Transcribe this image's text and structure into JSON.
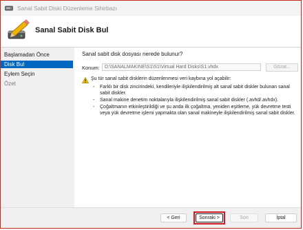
{
  "window": {
    "title": "Sanal Sabit Diski Düzenleme Sihirbazı"
  },
  "header": {
    "page_heading": "Sanal Sabit Disk Bul"
  },
  "nav": {
    "items": [
      {
        "label": "Başlamadan Önce"
      },
      {
        "label": "Disk Bul"
      },
      {
        "label": "Eylem Seçin"
      },
      {
        "label": "Özet"
      }
    ]
  },
  "content": {
    "prompt": "Sanal sabit disk dosyası nerede bulunur?",
    "location_label": "Konum:",
    "location_value": "D:\\SANALMAKINE\\S1\\S1\\Virtual Hard Disks\\S1.vhdx",
    "browse_label": "Gözat...",
    "warning_heading": "Şu tür sanal sabit disklerin düzenlenmesi veri kaybına yol açabilir:",
    "bullets": [
      "Farklı bir disk zincirindeki, kendileriyle ilişkilendirilmiş alt sanal sabit diskler bulunan sanal sabit diskler.",
      "Sanal makine denetim noktalarıyla ilişkilendirilmiş sanal sabit diskler (.avhd/.avhdx).",
      "Çoğaltmanın etkinleştirildiği ve şu anda ilk çoğaltma, yeniden eşitleme, yük devretme testi veya yük devretme işlemi yapmakta olan sanal makineyle ilişkilendirilmiş sanal sabit diskler."
    ]
  },
  "footer": {
    "back_label": "< Geri",
    "next_label": "Sonraki >",
    "finish_label": "Son",
    "cancel_label": "İptal"
  },
  "colors": {
    "accent": "#0067c0",
    "highlight": "#d01820"
  },
  "icons": {
    "app": "hard-disk-icon",
    "wizard": "disk-pencil-icon",
    "warning": "warning-icon"
  }
}
